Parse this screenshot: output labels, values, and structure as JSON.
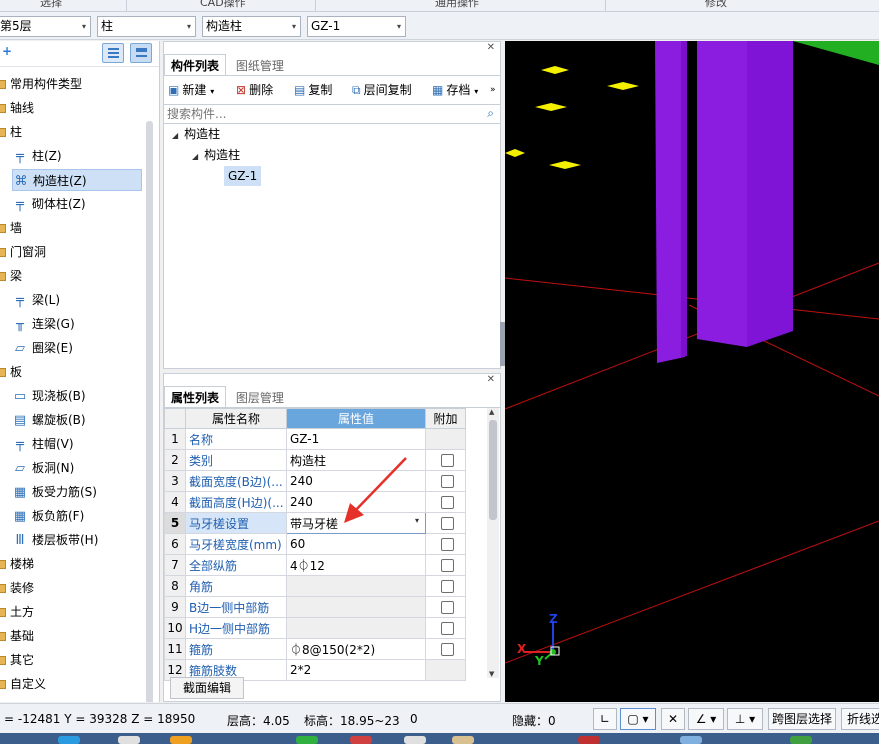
{
  "ribbon": {
    "groups": [
      "选择",
      "CAD操作",
      "通用操作",
      "修改"
    ]
  },
  "selectors": {
    "floor": "第5层",
    "type": "柱",
    "subtype": "构造柱",
    "component": "GZ-1"
  },
  "left_tree": {
    "items": [
      {
        "label": "常用构件类型",
        "kind": "folder",
        "icon": "folder-icon"
      },
      {
        "label": "轴线",
        "kind": "folder",
        "icon": "folder-icon"
      },
      {
        "label": "柱",
        "kind": "folder",
        "icon": "folder-icon"
      },
      {
        "label": "柱(Z)",
        "kind": "child",
        "icon": "column-icon"
      },
      {
        "label": "构造柱(Z)",
        "kind": "child",
        "icon": "constructional-column-icon",
        "selected": true
      },
      {
        "label": "砌体柱(Z)",
        "kind": "child",
        "icon": "masonry-column-icon"
      },
      {
        "label": "墙",
        "kind": "folder",
        "icon": "folder-icon"
      },
      {
        "label": "门窗洞",
        "kind": "folder",
        "icon": "folder-icon"
      },
      {
        "label": "梁",
        "kind": "folder",
        "icon": "folder-icon"
      },
      {
        "label": "梁(L)",
        "kind": "child",
        "icon": "beam-icon"
      },
      {
        "label": "连梁(G)",
        "kind": "child",
        "icon": "link-beam-icon"
      },
      {
        "label": "圈梁(E)",
        "kind": "child",
        "icon": "ring-beam-icon"
      },
      {
        "label": "板",
        "kind": "folder",
        "icon": "folder-icon"
      },
      {
        "label": "现浇板(B)",
        "kind": "child",
        "icon": "cast-slab-icon"
      },
      {
        "label": "螺旋板(B)",
        "kind": "child",
        "icon": "spiral-slab-icon"
      },
      {
        "label": "柱帽(V)",
        "kind": "child",
        "icon": "column-cap-icon"
      },
      {
        "label": "板洞(N)",
        "kind": "child",
        "icon": "slab-hole-icon"
      },
      {
        "label": "板受力筋(S)",
        "kind": "child",
        "icon": "slab-rebar-icon"
      },
      {
        "label": "板负筋(F)",
        "kind": "child",
        "icon": "negative-rebar-icon"
      },
      {
        "label": "楼层板带(H)",
        "kind": "child",
        "icon": "slab-strip-icon"
      },
      {
        "label": "楼梯",
        "kind": "folder",
        "icon": "folder-icon"
      },
      {
        "label": "装修",
        "kind": "folder",
        "icon": "folder-icon"
      },
      {
        "label": "土方",
        "kind": "folder",
        "icon": "folder-icon"
      },
      {
        "label": "基础",
        "kind": "folder",
        "icon": "folder-icon"
      },
      {
        "label": "其它",
        "kind": "folder",
        "icon": "folder-icon"
      },
      {
        "label": "自定义",
        "kind": "folder",
        "icon": "folder-icon"
      }
    ]
  },
  "component_panel": {
    "tabs": [
      "构件列表",
      "图纸管理"
    ],
    "toolbar": [
      "新建",
      "删除",
      "复制",
      "层间复制",
      "存档"
    ],
    "search_placeholder": "搜索构件...",
    "tree": {
      "root": "构造柱",
      "child": "构造柱",
      "leaf": "GZ-1"
    }
  },
  "property_panel": {
    "tabs": [
      "属性列表",
      "图层管理"
    ],
    "headers": {
      "name": "属性名称",
      "value": "属性值",
      "extra": "附加"
    },
    "rows": [
      {
        "n": "1",
        "name": "名称",
        "value": "GZ-1",
        "cb": false
      },
      {
        "n": "2",
        "name": "类别",
        "value": "构造柱",
        "cb": true
      },
      {
        "n": "3",
        "name": "截面宽度(B边)(...",
        "value": "240",
        "cb": true
      },
      {
        "n": "4",
        "name": "截面高度(H边)(...",
        "value": "240",
        "cb": true
      },
      {
        "n": "5",
        "name": "马牙槎设置",
        "value": "带马牙槎",
        "cb": true
      },
      {
        "n": "6",
        "name": "马牙槎宽度(mm)",
        "value": "60",
        "cb": true
      },
      {
        "n": "7",
        "name": "全部纵筋",
        "value": "4⏀12",
        "cb": true
      },
      {
        "n": "8",
        "name": "角筋",
        "value": "",
        "cb": true
      },
      {
        "n": "9",
        "name": "B边一侧中部筋",
        "value": "",
        "cb": true
      },
      {
        "n": "10",
        "name": "H边一侧中部筋",
        "value": "",
        "cb": true
      },
      {
        "n": "11",
        "name": "箍筋",
        "value": "⏀8@150(2*2)",
        "cb": true
      },
      {
        "n": "12",
        "name": "箍筋肢数",
        "value": "2*2",
        "cb": false
      }
    ],
    "section_button": "截面编辑"
  },
  "status_bar": {
    "coords": "= -12481 Y = 39328 Z = 18950",
    "floor_height": "层高：4.05",
    "elevation": "标高：18.95~23",
    "count": "0",
    "hidden": "隐藏：0",
    "cross_layer": "跨图层选择",
    "polyline": "折线选"
  },
  "axes": {
    "x": "X",
    "y": "Y",
    "z": "Z"
  },
  "colors": {
    "column": "#8a1de0",
    "marker": "#f4f000",
    "grid": "#c01010",
    "slab": "#22b022",
    "prop_header": "#6aa6de",
    "arrow": "#e6302a"
  }
}
